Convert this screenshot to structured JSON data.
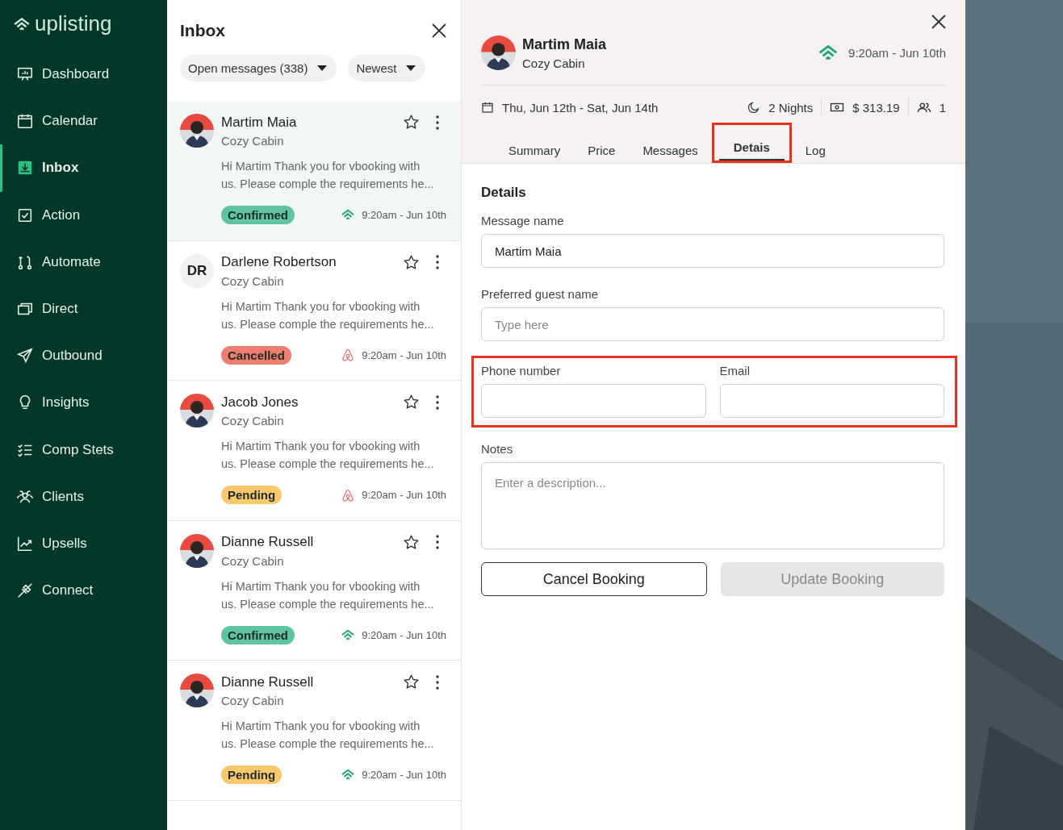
{
  "sidebar": {
    "logo": "uplisting",
    "items": [
      {
        "label": "Dashboard",
        "selected": false
      },
      {
        "label": "Calendar",
        "selected": false
      },
      {
        "label": "Inbox",
        "selected": true
      },
      {
        "label": "Action",
        "selected": false
      },
      {
        "label": "Automate",
        "selected": false
      },
      {
        "label": "Direct",
        "selected": false
      },
      {
        "label": "Outbound",
        "selected": false
      },
      {
        "label": "Insights",
        "selected": false
      },
      {
        "label": "Comp Stets",
        "selected": false
      },
      {
        "label": "Clients",
        "selected": false
      },
      {
        "label": "Upsells",
        "selected": false
      },
      {
        "label": "Connect",
        "selected": false
      }
    ]
  },
  "inbox": {
    "title": "Inbox",
    "filters": [
      "Open messages (338)",
      "Newest"
    ],
    "messages": [
      {
        "name": "Martim Maia",
        "property": "Cozy Cabin",
        "preview": "Hi Martim Thank you for vbooking with us. Please comple the requirements he...",
        "status": "Confirmed",
        "color": "#5fc4a0",
        "kind": "uplisting",
        "time": "9:20am - Jun 10th",
        "selected": true
      },
      {
        "name": "Darlene Robertson",
        "property": "Cozy Cabin",
        "avatar": {
          "kind": "initials",
          "text": "DR"
        },
        "preview": "Hi Martim Thank you for vbooking with us. Please comple the requirements he...",
        "status": "Cancelled",
        "color": "#ee7d70",
        "kind": "airbnb",
        "time": "9:20am - Jun 10th",
        "selected": false
      },
      {
        "name": "Jacob Jones",
        "property": "Cozy Cabin",
        "preview": "Hi Martim Thank you for vbooking with us. Please comple the requirements he...",
        "status": "Pending",
        "color": "#f8c96c",
        "kind": "airbnb",
        "time": "9:20am - Jun 10th",
        "selected": false
      },
      {
        "name": "Dianne Russell",
        "property": "Cozy Cabin",
        "preview": "Hi Martim Thank you for vbooking with us. Please comple the requirements he...",
        "status": "Confirmed",
        "color": "#5fc4a0",
        "kind": "uplisting",
        "time": "9:20am - Jun 10th",
        "selected": false
      },
      {
        "name": "Dianne Russell",
        "property": "Cozy Cabin",
        "preview": "Hi Martim Thank you for vbooking with us. Please comple the requirements he...",
        "status": "Pending",
        "color": "#f8c96c",
        "kind": "uplisting",
        "time": "9:20am - Jun 10th",
        "selected": false
      }
    ]
  },
  "booking": {
    "guest": "Martim Maia",
    "property": "Cozy Cabin",
    "time": "9:20am - Jun 10th",
    "dates": "Thu, Jun 12th - Sat, Jun 14th",
    "nights": "2 Nights",
    "price": "$ 313.19",
    "guests": "1",
    "tabs": [
      {
        "label": "Summary",
        "selected": false,
        "highlighted": false
      },
      {
        "label": "Price",
        "selected": false,
        "highlighted": false
      },
      {
        "label": "Messages",
        "selected": false,
        "highlighted": false
      },
      {
        "label": "Detais",
        "selected": true,
        "highlighted": true
      },
      {
        "label": "Log",
        "selected": false,
        "highlighted": false
      }
    ],
    "section_title": "Details",
    "rows": [
      {
        "highlighted": false,
        "fields": [
          {
            "label": "Message name",
            "value": "Martim Maia"
          }
        ]
      },
      {
        "highlighted": false,
        "fields": [
          {
            "label": "Preferred guest name",
            "placeholder": "Type here"
          }
        ]
      },
      {
        "highlighted": true,
        "fields": [
          {
            "label": "Phone number"
          },
          {
            "label": "Email"
          }
        ]
      },
      {
        "highlighted": false,
        "fields": [
          {
            "label": "Notes",
            "placeholder": "Enter a description...",
            "kind": "textarea"
          }
        ]
      }
    ],
    "buttons": [
      {
        "label": "Cancel Booking",
        "disabled": false
      },
      {
        "label": "Update Booking",
        "disabled": true
      }
    ]
  }
}
